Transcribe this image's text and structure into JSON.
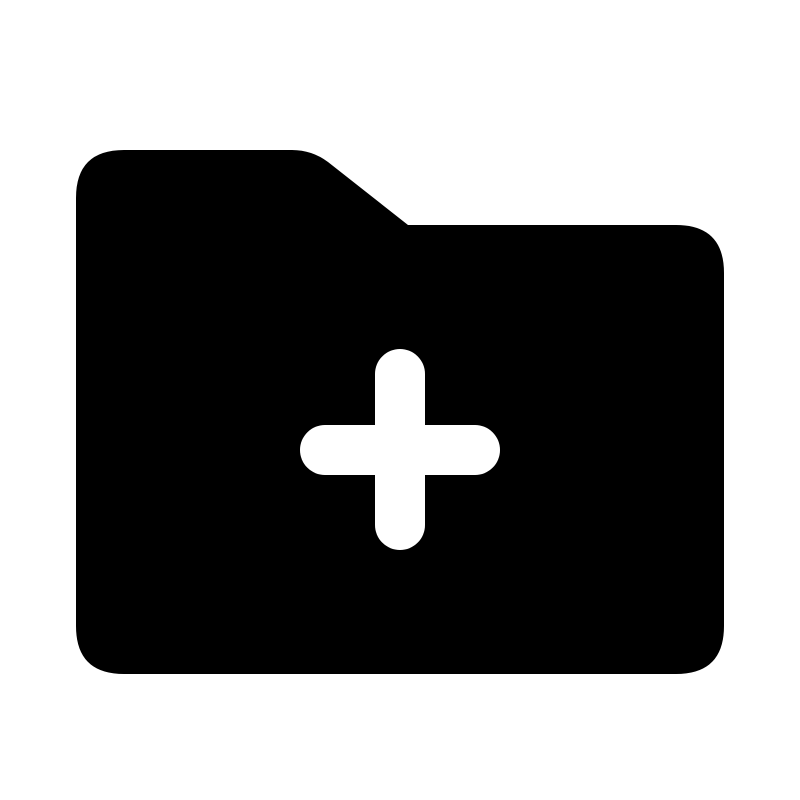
{
  "icon": {
    "name": "folder-plus-icon",
    "fill_color": "#000000",
    "plus_color": "#ffffff",
    "background_color": "#ffffff"
  }
}
